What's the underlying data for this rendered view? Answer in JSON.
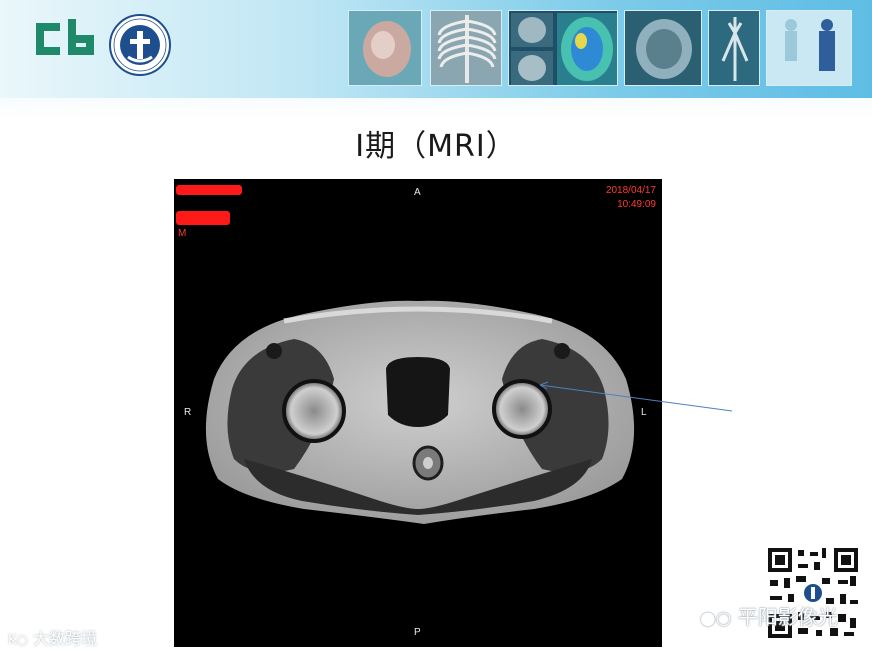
{
  "header": {
    "logo_text": "cb",
    "seal_text": "南阳市中心医院影像科",
    "thumbnails": [
      "heart-3d",
      "ribcage-3d",
      "brain-scans",
      "brain-perfusion",
      "brain-axial",
      "vessel-angiogram",
      "whole-body-scan"
    ]
  },
  "slide": {
    "title": "Ⅰ期（MRI）"
  },
  "viewer": {
    "orient_top": "A",
    "orient_bottom": "P",
    "orient_left": "R",
    "orient_right": "L",
    "date": "2018/04/17",
    "time": "10:49:09",
    "sex": "M"
  },
  "watermarks": {
    "right": "平阳影像光",
    "left": "大数跨境"
  },
  "colors": {
    "header_gradient_end": "#5fbde4",
    "redaction": "#ff1a1a",
    "overlay_text_red": "#ff3b2e",
    "annotation_arrow": "#4f7fc2"
  }
}
